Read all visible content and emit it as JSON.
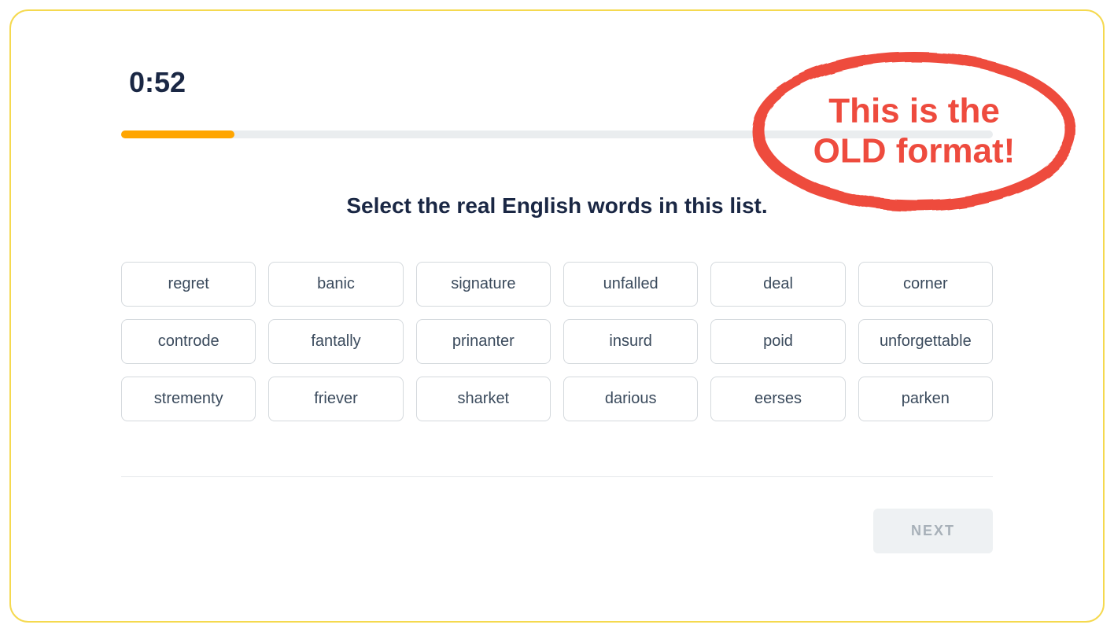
{
  "timer": "0:52",
  "progress_percent": 13,
  "prompt": "Select the real English words in this list.",
  "rows": [
    [
      "regret",
      "banic",
      "signature",
      "unfalled",
      "deal",
      "corner"
    ],
    [
      "controde",
      "fantally",
      "prinanter",
      "insurd",
      "poid",
      "unforgettable"
    ],
    [
      "strementy",
      "friever",
      "sharket",
      "darious",
      "eerses",
      "parken"
    ]
  ],
  "next_label": "NEXT",
  "annotation": {
    "line1": "This is the",
    "line2": "OLD format!",
    "color": "#ee4b3e"
  }
}
